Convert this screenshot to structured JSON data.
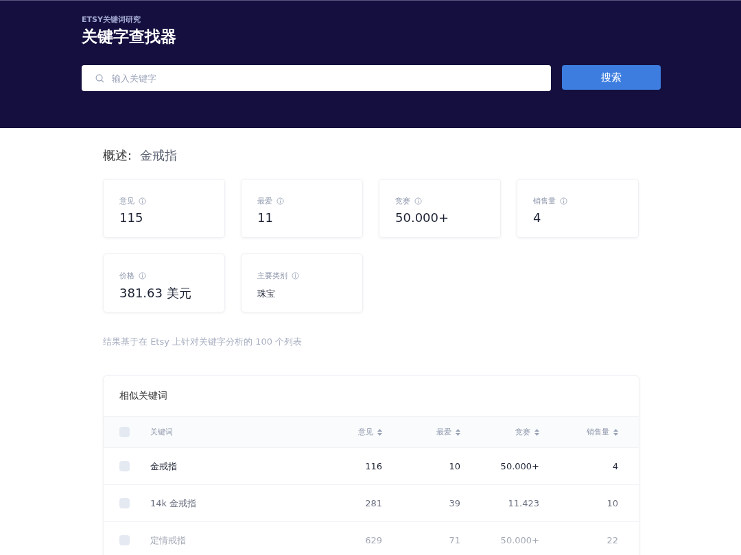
{
  "header": {
    "eyebrow": "ETSY关键词研究",
    "title": "关键字查找器",
    "search": {
      "placeholder": "输入关键字"
    },
    "search_button": "搜索"
  },
  "overview": {
    "label": "概述:",
    "keyword": "金戒指"
  },
  "stats": [
    {
      "label": "意见",
      "value": "115",
      "kind": "number"
    },
    {
      "label": "最爱",
      "value": "11",
      "kind": "number"
    },
    {
      "label": "竞赛",
      "value": "50.000+",
      "kind": "number"
    },
    {
      "label": "销售量",
      "value": "4",
      "kind": "number"
    },
    {
      "label": "价格",
      "value": "381.63 美元",
      "kind": "number"
    },
    {
      "label": "主要类别",
      "value": "珠宝",
      "kind": "text"
    }
  ],
  "note": "结果基于在 Etsy 上针对关键字分析的 100 个列表",
  "table": {
    "title": "相似关键词",
    "all_checked": false,
    "columns": [
      "关键词",
      "意见",
      "最爱",
      "竞赛",
      "销售量"
    ],
    "rows": [
      {
        "checked": false,
        "cells": [
          "金戒指",
          "116",
          "10",
          "50.000+",
          "4"
        ]
      },
      {
        "checked": false,
        "cells": [
          "14k 金戒指",
          "281",
          "39",
          "11.423",
          "10"
        ]
      },
      {
        "checked": false,
        "cells": [
          "定情戒指",
          "629",
          "71",
          "50.000+",
          "22"
        ]
      }
    ]
  }
}
